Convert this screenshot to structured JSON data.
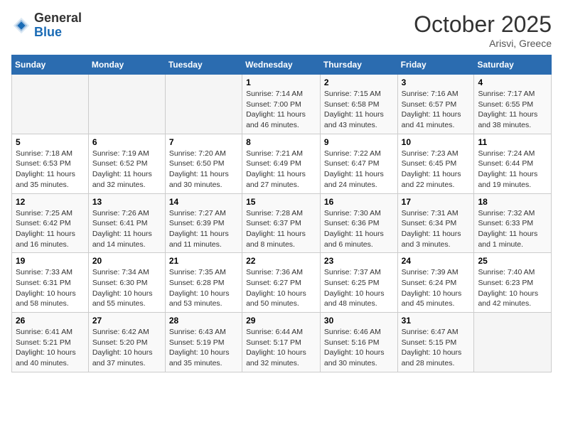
{
  "logo": {
    "general": "General",
    "blue": "Blue"
  },
  "title": "October 2025",
  "subtitle": "Arisvi, Greece",
  "days_of_week": [
    "Sunday",
    "Monday",
    "Tuesday",
    "Wednesday",
    "Thursday",
    "Friday",
    "Saturday"
  ],
  "weeks": [
    [
      {
        "day": "",
        "info": ""
      },
      {
        "day": "",
        "info": ""
      },
      {
        "day": "",
        "info": ""
      },
      {
        "day": "1",
        "info": "Sunrise: 7:14 AM\nSunset: 7:00 PM\nDaylight: 11 hours and 46 minutes."
      },
      {
        "day": "2",
        "info": "Sunrise: 7:15 AM\nSunset: 6:58 PM\nDaylight: 11 hours and 43 minutes."
      },
      {
        "day": "3",
        "info": "Sunrise: 7:16 AM\nSunset: 6:57 PM\nDaylight: 11 hours and 41 minutes."
      },
      {
        "day": "4",
        "info": "Sunrise: 7:17 AM\nSunset: 6:55 PM\nDaylight: 11 hours and 38 minutes."
      }
    ],
    [
      {
        "day": "5",
        "info": "Sunrise: 7:18 AM\nSunset: 6:53 PM\nDaylight: 11 hours and 35 minutes."
      },
      {
        "day": "6",
        "info": "Sunrise: 7:19 AM\nSunset: 6:52 PM\nDaylight: 11 hours and 32 minutes."
      },
      {
        "day": "7",
        "info": "Sunrise: 7:20 AM\nSunset: 6:50 PM\nDaylight: 11 hours and 30 minutes."
      },
      {
        "day": "8",
        "info": "Sunrise: 7:21 AM\nSunset: 6:49 PM\nDaylight: 11 hours and 27 minutes."
      },
      {
        "day": "9",
        "info": "Sunrise: 7:22 AM\nSunset: 6:47 PM\nDaylight: 11 hours and 24 minutes."
      },
      {
        "day": "10",
        "info": "Sunrise: 7:23 AM\nSunset: 6:45 PM\nDaylight: 11 hours and 22 minutes."
      },
      {
        "day": "11",
        "info": "Sunrise: 7:24 AM\nSunset: 6:44 PM\nDaylight: 11 hours and 19 minutes."
      }
    ],
    [
      {
        "day": "12",
        "info": "Sunrise: 7:25 AM\nSunset: 6:42 PM\nDaylight: 11 hours and 16 minutes."
      },
      {
        "day": "13",
        "info": "Sunrise: 7:26 AM\nSunset: 6:41 PM\nDaylight: 11 hours and 14 minutes."
      },
      {
        "day": "14",
        "info": "Sunrise: 7:27 AM\nSunset: 6:39 PM\nDaylight: 11 hours and 11 minutes."
      },
      {
        "day": "15",
        "info": "Sunrise: 7:28 AM\nSunset: 6:37 PM\nDaylight: 11 hours and 8 minutes."
      },
      {
        "day": "16",
        "info": "Sunrise: 7:30 AM\nSunset: 6:36 PM\nDaylight: 11 hours and 6 minutes."
      },
      {
        "day": "17",
        "info": "Sunrise: 7:31 AM\nSunset: 6:34 PM\nDaylight: 11 hours and 3 minutes."
      },
      {
        "day": "18",
        "info": "Sunrise: 7:32 AM\nSunset: 6:33 PM\nDaylight: 11 hours and 1 minute."
      }
    ],
    [
      {
        "day": "19",
        "info": "Sunrise: 7:33 AM\nSunset: 6:31 PM\nDaylight: 10 hours and 58 minutes."
      },
      {
        "day": "20",
        "info": "Sunrise: 7:34 AM\nSunset: 6:30 PM\nDaylight: 10 hours and 55 minutes."
      },
      {
        "day": "21",
        "info": "Sunrise: 7:35 AM\nSunset: 6:28 PM\nDaylight: 10 hours and 53 minutes."
      },
      {
        "day": "22",
        "info": "Sunrise: 7:36 AM\nSunset: 6:27 PM\nDaylight: 10 hours and 50 minutes."
      },
      {
        "day": "23",
        "info": "Sunrise: 7:37 AM\nSunset: 6:25 PM\nDaylight: 10 hours and 48 minutes."
      },
      {
        "day": "24",
        "info": "Sunrise: 7:39 AM\nSunset: 6:24 PM\nDaylight: 10 hours and 45 minutes."
      },
      {
        "day": "25",
        "info": "Sunrise: 7:40 AM\nSunset: 6:23 PM\nDaylight: 10 hours and 42 minutes."
      }
    ],
    [
      {
        "day": "26",
        "info": "Sunrise: 6:41 AM\nSunset: 5:21 PM\nDaylight: 10 hours and 40 minutes."
      },
      {
        "day": "27",
        "info": "Sunrise: 6:42 AM\nSunset: 5:20 PM\nDaylight: 10 hours and 37 minutes."
      },
      {
        "day": "28",
        "info": "Sunrise: 6:43 AM\nSunset: 5:19 PM\nDaylight: 10 hours and 35 minutes."
      },
      {
        "day": "29",
        "info": "Sunrise: 6:44 AM\nSunset: 5:17 PM\nDaylight: 10 hours and 32 minutes."
      },
      {
        "day": "30",
        "info": "Sunrise: 6:46 AM\nSunset: 5:16 PM\nDaylight: 10 hours and 30 minutes."
      },
      {
        "day": "31",
        "info": "Sunrise: 6:47 AM\nSunset: 5:15 PM\nDaylight: 10 hours and 28 minutes."
      },
      {
        "day": "",
        "info": ""
      }
    ]
  ]
}
